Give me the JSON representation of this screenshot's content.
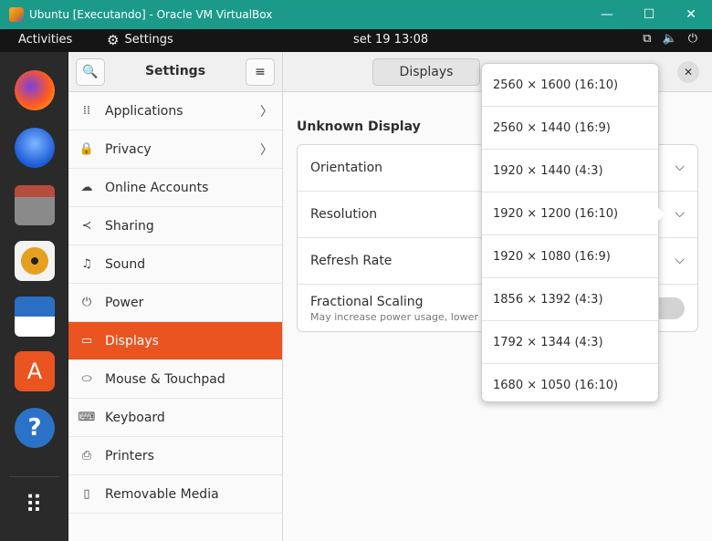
{
  "vbox": {
    "title": "Ubuntu [Executando] - Oracle VM VirtualBox",
    "minimize": "—",
    "maximize": "☐",
    "close": "✕"
  },
  "topbar": {
    "activities": "Activities",
    "app_name": "Settings",
    "clock": "set 19  13:08",
    "tray": {
      "network": "⧉",
      "volume": "🔈",
      "power": "⏻"
    }
  },
  "dock": {
    "items": [
      "firefox",
      "thunderbird",
      "files",
      "rhythmbox",
      "libreoffice-writer",
      "software",
      "help",
      "show-apps"
    ],
    "help_glyph": "?",
    "store_glyph": "A",
    "grid_glyph": "⠿"
  },
  "settings": {
    "header_title": "Settings",
    "search_glyph": "🔍",
    "menu_glyph": "≡",
    "sidebar": [
      {
        "label": "Applications",
        "icon": "⁞⁞",
        "chevron": "〉"
      },
      {
        "label": "Privacy",
        "icon": "🔒",
        "chevron": "〉"
      },
      {
        "label": "Online Accounts",
        "icon": "☁",
        "chevron": ""
      },
      {
        "label": "Sharing",
        "icon": "≺",
        "chevron": ""
      },
      {
        "label": "Sound",
        "icon": "♫",
        "chevron": ""
      },
      {
        "label": "Power",
        "icon": "⏻",
        "chevron": ""
      },
      {
        "label": "Displays",
        "icon": "▭",
        "chevron": ""
      },
      {
        "label": "Mouse & Touchpad",
        "icon": "⬭",
        "chevron": ""
      },
      {
        "label": "Keyboard",
        "icon": "⌨",
        "chevron": ""
      },
      {
        "label": "Printers",
        "icon": "⎙",
        "chevron": ""
      },
      {
        "label": "Removable Media",
        "icon": "▯",
        "chevron": ""
      }
    ],
    "active_index": 6,
    "content_tab": "Displays",
    "close_glyph": "✕",
    "display_name": "Unknown Display",
    "options": {
      "orientation": "Orientation",
      "resolution": "Resolution",
      "refresh_rate": "Refresh Rate",
      "fractional": "Fractional Scaling",
      "fractional_sub": "May increase power usage, lower sp",
      "chevron": "⌵"
    },
    "resolutions": [
      "2560 × 1600 (16:10)",
      "2560 × 1440 (16:9)",
      "1920 × 1440 (4:3)",
      "1920 × 1200 (16:10)",
      "1920 × 1080 (16:9)",
      "1856 × 1392 (4:3)",
      "1792 × 1344 (4:3)",
      "1680 × 1050 (16:10)"
    ]
  }
}
